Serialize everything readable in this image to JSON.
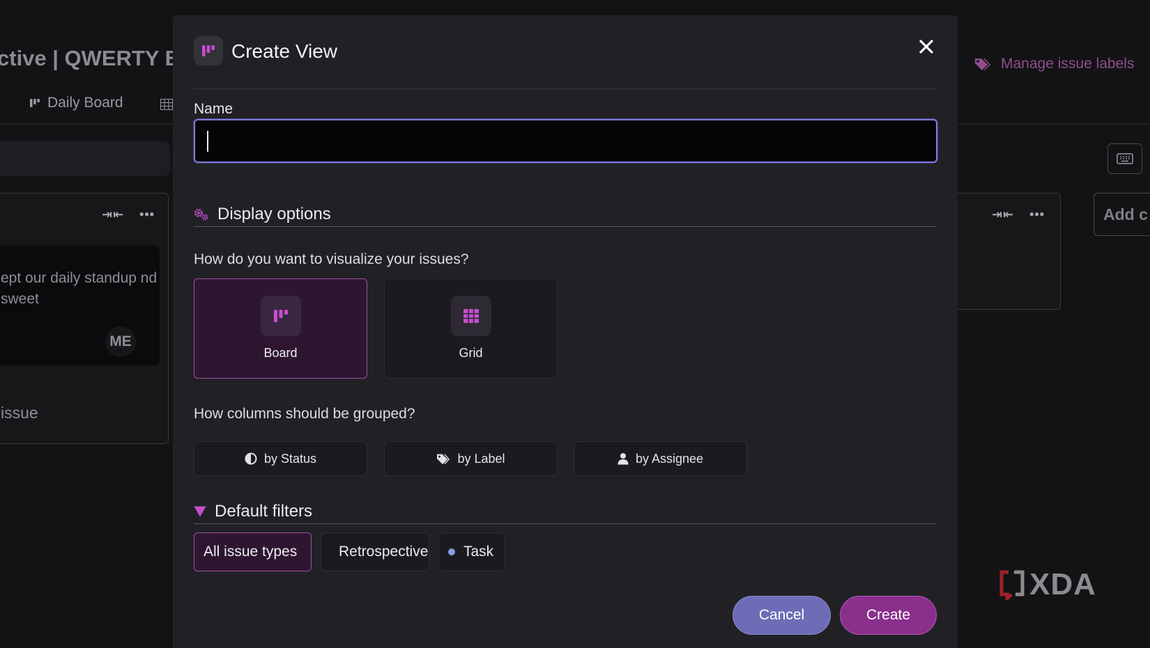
{
  "background": {
    "title": "ctive | QWERTY B",
    "tab_label": "Daily Board",
    "column_controls": "⇥⇤",
    "more": "•••",
    "card_text": "ept our daily standup nd sweet",
    "avatar": "ME",
    "add_issue": "issue",
    "manage_labels": "Manage issue labels",
    "add_column": "Add c",
    "watermark": "XDA"
  },
  "modal": {
    "title": "Create View",
    "name_label": "Name",
    "name_value": "",
    "display_options": {
      "heading": "Display options",
      "question": "How do you want to visualize your issues?",
      "views": [
        {
          "label": "Board",
          "icon": "board-icon",
          "selected": true
        },
        {
          "label": "Grid",
          "icon": "grid-icon",
          "selected": false
        }
      ]
    },
    "grouping": {
      "question": "How columns should be grouped?",
      "options": [
        {
          "label": "by Status",
          "icon": "half-circle-icon"
        },
        {
          "label": "by Label",
          "icon": "tags-icon"
        },
        {
          "label": "by Assignee",
          "icon": "user-icon"
        }
      ]
    },
    "filters": {
      "heading": "Default filters",
      "chips": [
        {
          "label": "All issue types",
          "selected": true
        },
        {
          "label": "Retrospective",
          "dot_color": "#3fc0b0"
        },
        {
          "label": "Task",
          "dot_color": "#7fa3d8"
        }
      ]
    },
    "cancel_label": "Cancel",
    "create_label": "Create"
  },
  "colors": {
    "accent_purple": "#a24ea6",
    "icon_purple": "#c64fd0",
    "focus_ring": "#7d7bd6",
    "cancel_bg": "#6e6cb6",
    "create_bg": "#8a2f8c"
  }
}
